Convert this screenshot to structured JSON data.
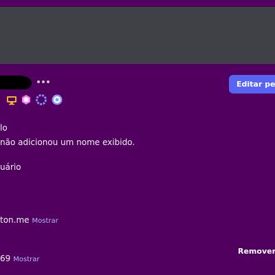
{
  "profile": {
    "edit_button_label": "Editar perfil",
    "display_name_heading": "lo",
    "display_name_text": "não adicionou um nome exibido.",
    "username_heading": "uário"
  },
  "connections": [
    {
      "text": "ton.me",
      "link": "Mostrar"
    },
    {
      "text": "69",
      "link": "Mostrar"
    }
  ],
  "remove_label": "Remover",
  "colors": {
    "background": "#52005f",
    "banner": "#3f4146",
    "accent_button": "#5865f2",
    "link": "#aeb6ff"
  },
  "badges": [
    "computer-icon",
    "nitro-gem-icon",
    "server-booster-icon",
    "quest-badge-icon"
  ]
}
